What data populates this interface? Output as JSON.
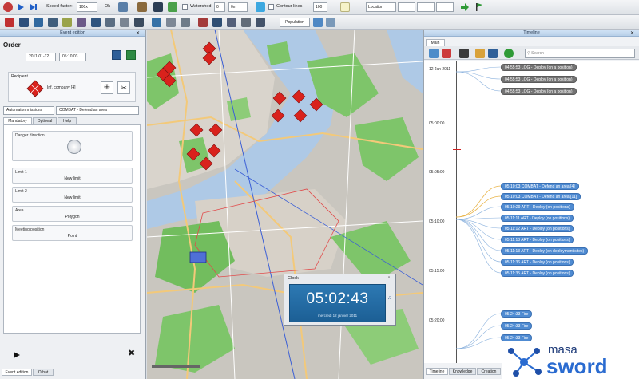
{
  "toolbar": {
    "speed_label": "Speed factor:",
    "speed_value": "100x",
    "ok_label": "Ok",
    "watershed_label": "Watershed",
    "watershed_value": "0",
    "watershed_unit": "0m",
    "contour_label": "Contour lines",
    "contour_value": "100",
    "location_label": "Location",
    "population_label": "Population"
  },
  "event_panel": {
    "title": "Event edition",
    "order_title": "Order",
    "date": "2011-01-12",
    "time": "05:10:03",
    "recipient_label": "Recipient",
    "recipient_name": "Inf. company [4]",
    "mission_category": "Automaton missions",
    "mission": "COMBAT - Defend an area",
    "tabs": [
      "Mandatory",
      "Optional",
      "Help"
    ],
    "danger_direction": "Danger direction",
    "limit1_label": "Limit 1",
    "limit1_value": "New limit",
    "limit2_label": "Limit 2",
    "limit2_value": "New limit",
    "area_label": "Area",
    "area_value": "Polygon",
    "meeting_label": "Meeting position",
    "meeting_value": "Point",
    "bottom_tabs": [
      "Event edition",
      "Orbat"
    ]
  },
  "timeline": {
    "title": "Timeline",
    "tab_main": "Main",
    "search_placeholder": "Search",
    "date_label": "12 Jan 2011",
    "times": [
      "05:00:00",
      "05:05:00",
      "05:10:00",
      "05:15:00",
      "05:20:00"
    ],
    "events_grey": [
      "04:55:53  LOG - Deploy (on a position)",
      "04:55:53  LOG - Deploy (on a position)",
      "04:55:53  LOG - Deploy (on a position)"
    ],
    "events_blue": [
      "05:10:03  COMBAT - Defend an area [4]",
      "05:10:03  COMBAT - Defend an area [11]",
      "05:10:29  ART - Deploy (on positions)",
      "05:11:11  ART - Deploy (on positions)",
      "05:11:12  ART - Deploy (on positions)",
      "05:11:13  ART - Deploy (on positions)",
      "05:11:13  ART - Deploy (on deployment sites)",
      "05:11:36  ART - Deploy (on positions)",
      "05:11:35  ART - Deploy (on positions)"
    ],
    "events_fire": [
      "05:24:33  Fire",
      "05:24:33  Fire",
      "05:24:33  Fire"
    ],
    "bottom_tabs": [
      "Timeline",
      "Knowledge",
      "Creation"
    ]
  },
  "clock": {
    "title": "Clock",
    "time": "05:02:43",
    "date": "mercredi 12 janvier 2011"
  },
  "logo": {
    "line1": "masa",
    "line2": "sword"
  },
  "colors": {
    "accent": "#2d79b3",
    "unit_red": "#d9221c",
    "timeline_blue": "#4f8bd2",
    "timeline_grey": "#737373",
    "map_green": "#7ec56a",
    "water": "#aec9e6"
  }
}
